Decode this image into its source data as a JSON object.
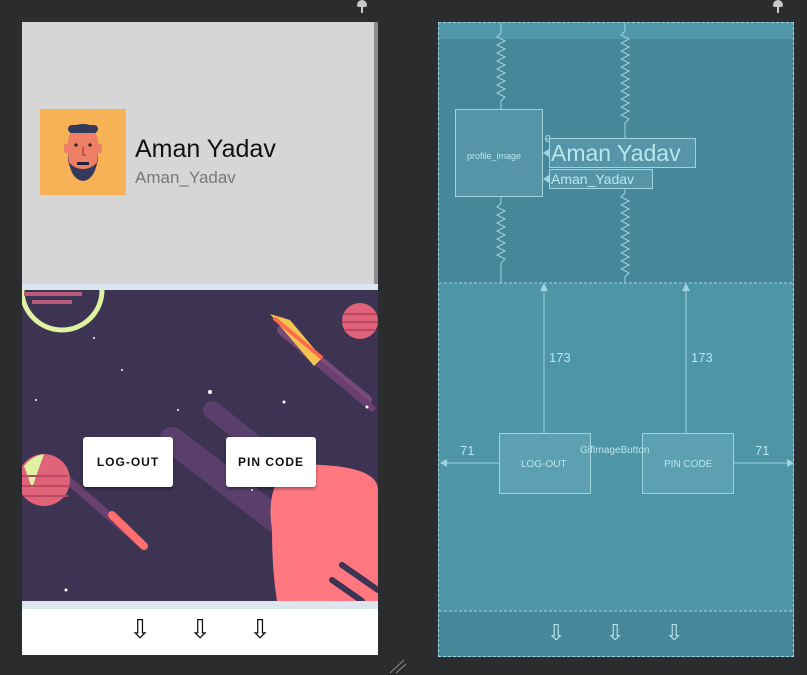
{
  "profile": {
    "name": "Aman Yadav",
    "username": "Aman_Yadav"
  },
  "buttons": {
    "logout": "LOG-OUT",
    "pin_code": "PIN CODE"
  },
  "bottom_nav": {
    "arrows": [
      "⇩",
      "⇩",
      "⇩"
    ]
  },
  "blueprint": {
    "profile_image_id": "profile_image",
    "name": "Aman Yadav",
    "username": "Aman_Yadav",
    "margin_top": "173",
    "margin_side": "71",
    "logout": "LOG-OUT",
    "pin_code": "PIN CODE",
    "group_label": "GifImageButton",
    "baseline_marker": "0"
  },
  "colors": {
    "avatar_bg": "#f6b255",
    "header_bg": "#d6d6d6",
    "art_bg": "#3d3453",
    "blueprint_bg": "#4f95a8"
  }
}
